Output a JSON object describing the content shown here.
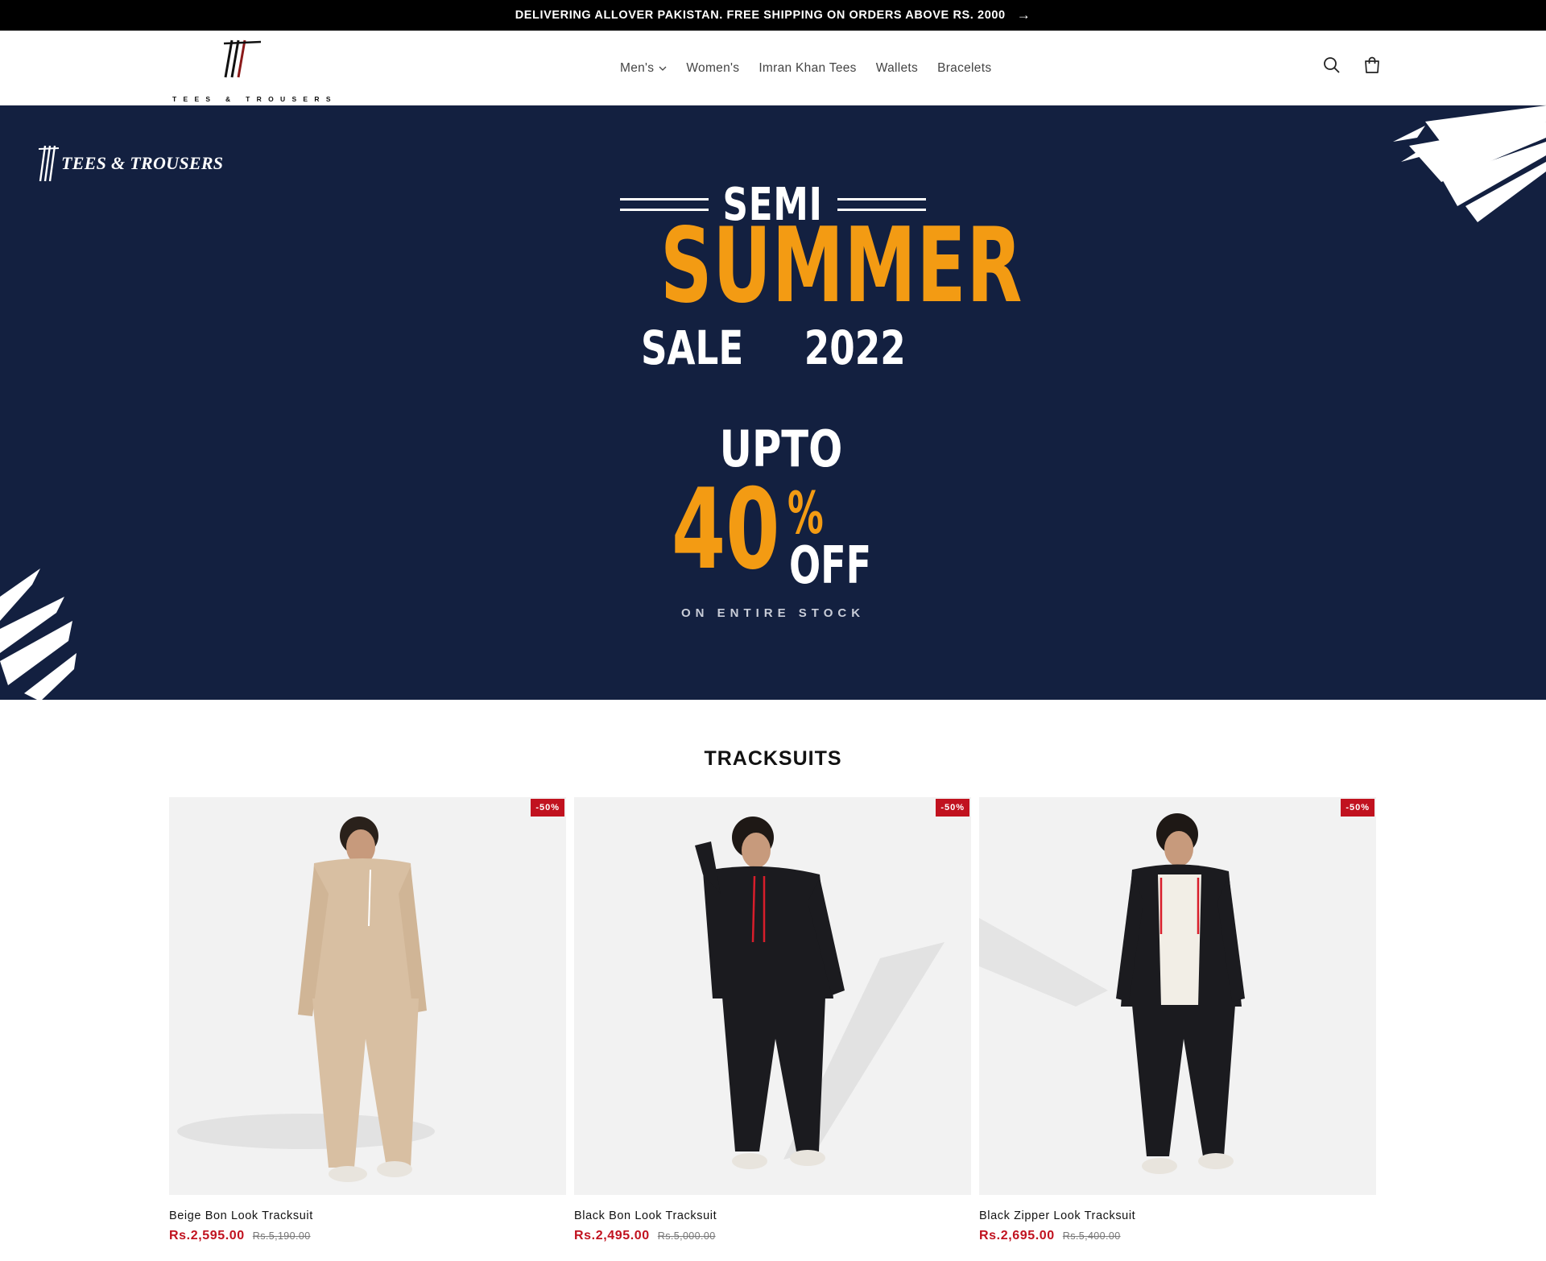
{
  "announcement": {
    "text": "DELIVERING ALLOVER PAKISTAN. FREE SHIPPING ON ORDERS ABOVE RS. 2000",
    "arrow_icon": "arrow-right-icon"
  },
  "header": {
    "logo_wordmark": "TEES & TROUSERS",
    "nav": [
      {
        "label": "Men's",
        "has_dropdown": true
      },
      {
        "label": "Women's"
      },
      {
        "label": "Imran Khan Tees"
      },
      {
        "label": "Wallets"
      },
      {
        "label": "Bracelets"
      }
    ],
    "icons": [
      "search-icon",
      "cart-icon"
    ]
  },
  "hero": {
    "brand": "TEES & TROUSERS",
    "semi": "SEMI",
    "summer": "SUMMER",
    "sale": "SALE",
    "year": "2022",
    "upto": "UPTO",
    "discount": "40",
    "percent": "%",
    "off": "OFF",
    "subline": "ON ENTIRE STOCK",
    "colors": {
      "background": "#132040",
      "accent": "#f39b13"
    }
  },
  "section": {
    "title": "TRACKSUITS",
    "products": [
      {
        "badge": "-50%",
        "title": "Beige Bon Look Tracksuit",
        "price": "Rs.2,595.00",
        "compare_price": "Rs.5,190.00",
        "garment_color": "#d8bfa2"
      },
      {
        "badge": "-50%",
        "title": "Black Bon Look Tracksuit",
        "price": "Rs.2,495.00",
        "compare_price": "Rs.5,000.00",
        "garment_color": "#1b1b1f"
      },
      {
        "badge": "-50%",
        "title": "Black Zipper Look Tracksuit",
        "price": "Rs.2,695.00",
        "compare_price": "Rs.5,400.00",
        "garment_color": "#1b1b1f"
      }
    ]
  },
  "colors": {
    "sale_red": "#c1121f",
    "badge_red": "#c1121f"
  }
}
